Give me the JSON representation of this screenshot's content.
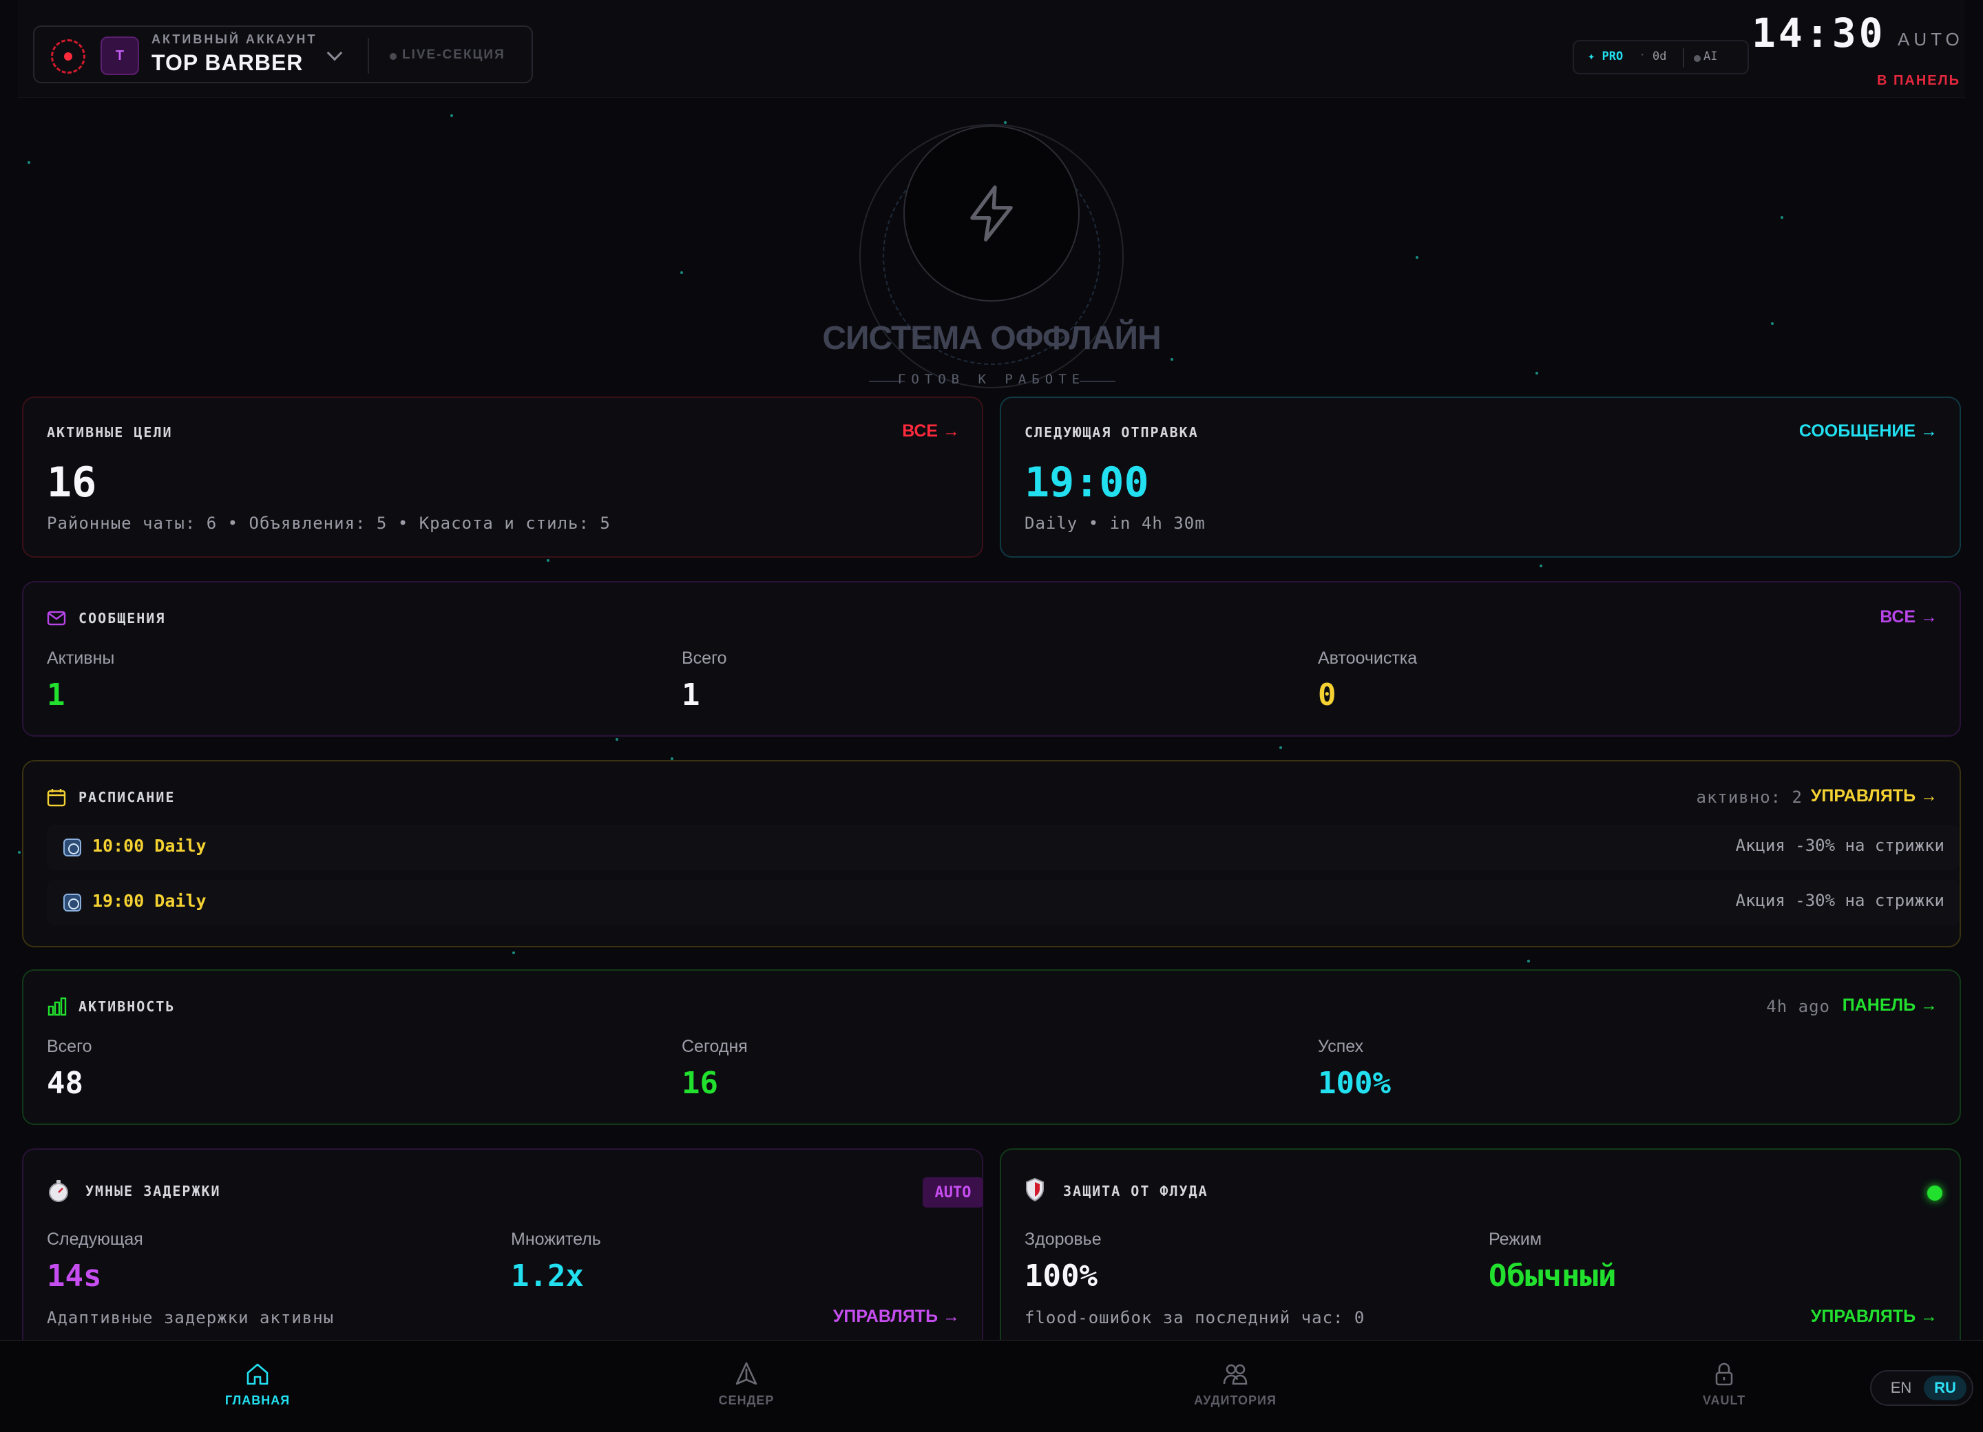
{
  "header": {
    "account_caption": "АКТИВНЫЙ АККАУНТ",
    "account_name": "TOP BARBER",
    "account_initial": "T",
    "live_section": "LIVE-СЕКЦИЯ",
    "badge_pro": "✦ PRO",
    "badge_sep": "·",
    "badge_days": "0d",
    "badge_ai": "AI",
    "clock": "14:30",
    "auto": "AUTO",
    "to_panel": "В ПАНЕЛЬ"
  },
  "hero": {
    "title": "СИСТЕМА ОФФЛАЙН",
    "subtitle": "ГОТОВ К РАБОТЕ",
    "icon": "lightning-icon"
  },
  "targets": {
    "title": "АКТИВНЫЕ ЦЕЛИ",
    "link": "ВСЕ →",
    "value": "16",
    "meta": "Районные чаты: 6 • Объявления: 5 • Красота и стиль: 5"
  },
  "next_send": {
    "title": "СЛЕДУЮЩАЯ ОТПРАВКА",
    "link": "СООБЩЕНИЕ →",
    "value": "19:00",
    "meta": "Daily • in 4h 30m"
  },
  "messages": {
    "title": "СООБЩЕНИЯ",
    "link": "ВСЕ →",
    "stats": [
      {
        "label": "Активны",
        "value": "1"
      },
      {
        "label": "Всего",
        "value": "1"
      },
      {
        "label": "Автоочистка",
        "value": "0"
      }
    ]
  },
  "schedule": {
    "title": "РАСПИСАНИЕ",
    "active": "активно: 2",
    "link": "УПРАВЛЯТЬ →",
    "rows": [
      {
        "time": "10:00 Daily",
        "text": "Акция -30% на стрижки"
      },
      {
        "time": "19:00 Daily",
        "text": "Акция -30% на стрижки"
      }
    ]
  },
  "activity": {
    "title": "АКТИВНОСТЬ",
    "ago": "4h ago",
    "link": "ПАНЕЛЬ →",
    "stats": [
      {
        "label": "Всего",
        "value": "48"
      },
      {
        "label": "Сегодня",
        "value": "16"
      },
      {
        "label": "Успех",
        "value": "100%"
      }
    ]
  },
  "delays": {
    "title": "УМНЫЕ ЗАДЕРЖКИ",
    "chip": "AUTO",
    "stats": [
      {
        "label": "Следующая",
        "value": "14s"
      },
      {
        "label": "Множитель",
        "value": "1.2x"
      }
    ],
    "footer": "Адаптивные задержки активны",
    "link": "УПРАВЛЯТЬ →"
  },
  "flood": {
    "title": "ЗАЩИТА ОТ ФЛУДА",
    "stats": [
      {
        "label": "Здоровье",
        "value": "100%"
      },
      {
        "label": "Режим",
        "value": "Обычный"
      }
    ],
    "footer": "flood-ошибок за последний час: 0",
    "link": "УПРАВЛЯТЬ →"
  },
  "nav": {
    "items": [
      {
        "label": "ГЛАВНАЯ",
        "icon": "home-icon"
      },
      {
        "label": "СЕНДЕР",
        "icon": "send-icon"
      },
      {
        "label": "АУДИТОРИЯ",
        "icon": "users-icon"
      },
      {
        "label": "VAULT",
        "icon": "lock-icon"
      }
    ],
    "lang_en": "EN",
    "lang_ru": "RU"
  },
  "colors": {
    "bg": "#09090d",
    "red": "#ff2a3c",
    "cyan": "#22e0f0",
    "green": "#22e02e",
    "yellow": "#f5d232",
    "purple": "#c64ef0"
  }
}
